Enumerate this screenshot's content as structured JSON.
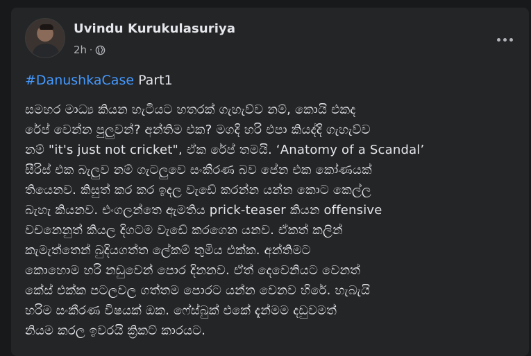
{
  "post": {
    "author_name": "Uvindu Kurukulasuriya",
    "timestamp": "2h",
    "separator": "·",
    "privacy_icon": "globe-icon",
    "more_icon": "more-options-icon",
    "hashtag": "#DanushkaCase",
    "hashtag_suffix": " Part1",
    "body_lines": [
      "සමහර මාධ්‍ය කියන හැටියට හතරක් ගැහැව්ව නම්, කොයි එකද",
      "රේප් වෙන්න පුලුවන්? අන්තිම එක? මගදි හරි එපා කියද්දි ගැහැව්ව",
      "නම් \"it's just not cricket\", ඒක රේප් තමයි. ‘Anatomy of a Scandal’",
      "සීරිස් එක බැලුව නම් ගැටලුවෙ සංකීරණ බව පේන එක කෝණයක්",
      "තියෙනව. කිසුත් කර කර ඉදල වැඩේ කරන්න යන්න කොට කෙල්ල",
      "බැහැ කියනව. එංගලන්තෙ ඇමතිය prick-teaser කියන offensive",
      "වචනෙනුත් කියල දිගටම වැඩේ කරගෙන යනව. ඒකත් කලින්",
      "කැමැත්තෙන් බුදියගත්ත ලේකම් තුමිය එක්ක. අන්තිමට",
      "කොහොම හරි නඩුවෙන් පොර දිනනව. ඒත් දෙවෙනියට වෙනත්",
      "කේස් එක්ක පටලවල ගත්තම පොරට යන්න වෙනව හිරේ. හැබැයි",
      "හරිම සංකීරණ විෂයක් ඔක. ෆේස්බුක් එකේ දැන්මම දඩුවමත්",
      "නියම කරල ඉවරයි ක්‍රිකට් කාරයට."
    ]
  },
  "colors": {
    "page_bg": "#18191a",
    "card_bg": "#242526",
    "primary_text": "#e4e6eb",
    "secondary_text": "#b0b3b8",
    "link": "#4599ff"
  }
}
